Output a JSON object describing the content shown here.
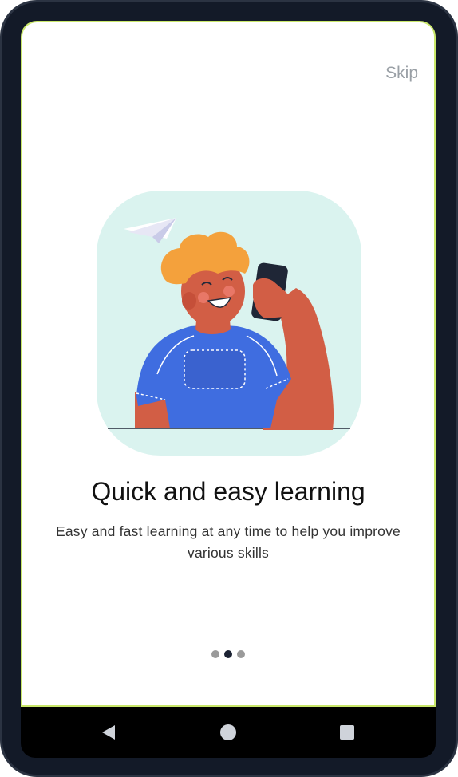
{
  "header": {
    "skip_label": "Skip"
  },
  "onboarding": {
    "title": "Quick and easy learning",
    "subtitle": "Easy and fast learning at any time to help you improve various skills",
    "illustration_icon": "student-with-phone-illustration"
  },
  "pager": {
    "total": 3,
    "active": 2
  },
  "navigation": {
    "back_icon": "back-triangle-icon",
    "home_icon": "home-circle-icon",
    "recents_icon": "recents-square-icon"
  },
  "colors": {
    "accent_border": "#c9e76a",
    "illustration_bg": "#daf3ef",
    "shirt": "#3f6de0",
    "skin": "#d25e45",
    "hair": "#f4a13c",
    "active_dot": "#1b2233",
    "inactive_dot": "#9a9a9a"
  }
}
